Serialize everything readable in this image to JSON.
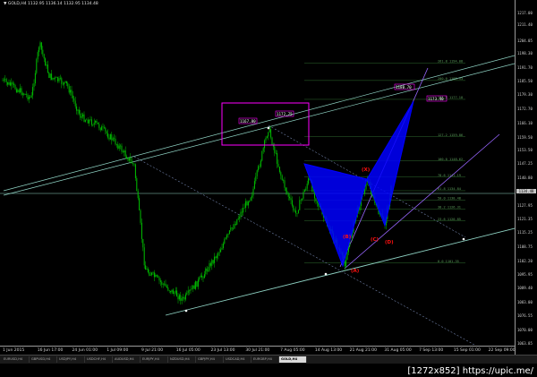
{
  "header": {
    "symbol_line": "▼ GOLD,H4  1132.95  1136.14  1132.95  1134.48"
  },
  "colors": {
    "candle": "#00c000",
    "background": "#000000",
    "pattern_fill": "#0000ff",
    "pattern_label": "#ff1010",
    "channel_line": "#8fd3c4",
    "trendline": "#9966ff",
    "box": "#ff00ff"
  },
  "price_axis": {
    "ticks": [
      "1217.00",
      "1211.40",
      "1204.05",
      "1198.30",
      "1191.70",
      "1185.50",
      "1179.30",
      "1172.70",
      "1166.10",
      "1159.50",
      "1153.50",
      "1147.25",
      "1140.80",
      "1134.40",
      "1127.95",
      "1121.35",
      "1115.25",
      "1108.75",
      "1102.20",
      "1095.95",
      "1089.40",
      "1083.00",
      "1076.55",
      "1070.00",
      "1063.85"
    ],
    "current_price_label": "1134.48"
  },
  "time_axis": {
    "labels": [
      "1 Jun 2015",
      "16 Jun 17:00",
      "24 Jun 01:00",
      "1 Jul 09:00",
      "9 Jul 21:00",
      "16 Jul 05:00",
      "23 Jul 13:00",
      "30 Jul 21:00",
      "7 Aug 05:00",
      "14 Aug 13:00",
      "21 Aug 21:00",
      "31 Aug 05:00",
      "7 Sep 13:00",
      "15 Sep 01:00",
      "22 Sep 09:00"
    ]
  },
  "pattern": {
    "points": [
      "(X)",
      "(A)",
      "(B)",
      "(C)",
      "(D)"
    ]
  },
  "fib_levels": [
    {
      "label": "261.8  1194.08",
      "price": 1194.08
    },
    {
      "label": "200.0  1185.93",
      "price": 1185.93
    },
    {
      "label": "161.8  1177.18",
      "price": 1177.18
    },
    {
      "label": "127.2  1159.86",
      "price": 1159.86
    },
    {
      "label": "100.0  1148.62",
      "price": 1148.62
    },
    {
      "label": "78.6  1141.19",
      "price": 1141.19
    },
    {
      "label": "61.8  1134.84",
      "price": 1134.84
    },
    {
      "label": "50.0  1130.48",
      "price": 1130.48
    },
    {
      "label": "38.2  1126.31",
      "price": 1126.31
    },
    {
      "label": "23.6  1120.85",
      "price": 1120.85
    },
    {
      "label": "0.0  1101.35",
      "price": 1101.35
    }
  ],
  "box_labels": [
    "1167.80",
    "1172.75"
  ],
  "target_labels": [
    "1180.70",
    "1173.40"
  ],
  "tabs": [
    "EURUSD,H4",
    "GBPUSD,H4",
    "USDJPY,H4",
    "USDCHF,H4",
    "AUDUSD,H4",
    "EURJPY,H4",
    "NZDUSD,H4",
    "GBPJPY,H4",
    "USDCAD,H4",
    "EURGBP,H4",
    "GOLD,H4"
  ],
  "watermark": "[1272x852] https://upic.me/"
}
